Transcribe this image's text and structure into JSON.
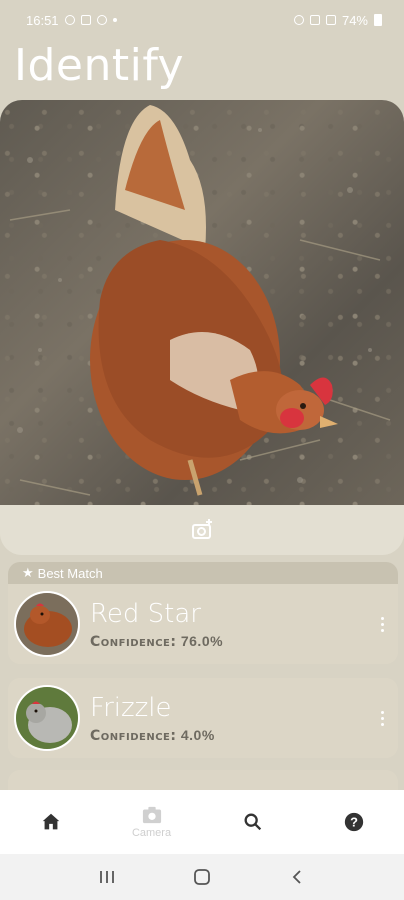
{
  "status_bar": {
    "time": "16:51",
    "battery": "74%"
  },
  "page": {
    "title": "Identify"
  },
  "photo": {
    "subject_icon": "hen-photo",
    "camera_button_icon": "add-photo-icon"
  },
  "results": {
    "best_match_label": "Best Match",
    "best_match_icon": "star-icon",
    "items": [
      {
        "name": "Red Star",
        "confidence_label": "Confidence:",
        "confidence_value": "76.0%"
      },
      {
        "name": "Frizzle",
        "confidence_label": "Confidence:",
        "confidence_value": "4.0%"
      }
    ]
  },
  "bottom_nav": {
    "items": [
      {
        "icon": "home-icon",
        "label": ""
      },
      {
        "icon": "camera-icon",
        "label": "Camera"
      },
      {
        "icon": "search-icon",
        "label": ""
      },
      {
        "icon": "help-icon",
        "label": ""
      }
    ]
  },
  "colors": {
    "background": "#d8d3c4",
    "card": "#dcd6c6",
    "header": "#c8c2b1",
    "text_muted": "#6e6a60"
  }
}
